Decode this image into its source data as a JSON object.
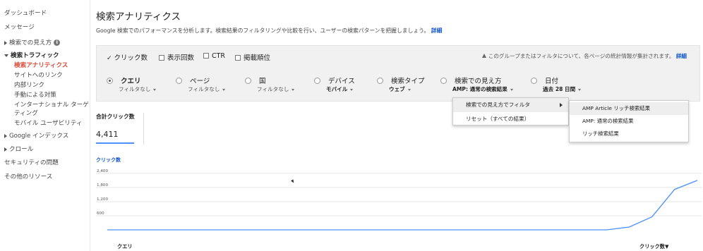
{
  "sidebar": {
    "dashboard": "ダッシュボード",
    "messages": "メッセージ",
    "search_appearance": "検索での見え方",
    "search_traffic": "検索トラフィック",
    "search_analytics": "検索アナリティクス",
    "links_to_site": "サイトへのリンク",
    "internal_links": "内部リンク",
    "manual_actions": "手動による対策",
    "intl_targeting_1": "インターナショナル ターゲ",
    "intl_targeting_2": "ティング",
    "mobile_usability": "モバイル ユーザビリティ",
    "google_index": "Google インデックス",
    "crawl": "クロール",
    "security_issues": "セキュリティの問題",
    "other_resources": "その他のリソース"
  },
  "header": {
    "title": "検索アナリティクス",
    "description": "Google 検索でのパフォーマンスを分析します。検索結果のフィルタリングや比較を行い、ユーザーの検索パターンを把握しましょう。",
    "details_link": "詳細"
  },
  "metrics": {
    "clicks": "クリック数",
    "impressions": "表示回数",
    "ctr": "CTR",
    "position": "掲載順位",
    "notice": "このグループまたはフィルタについて、各ページの統計情報が集計されます。",
    "notice_link": "詳細"
  },
  "dimensions": [
    {
      "label": "クエリ",
      "filter": "フィルタなし",
      "selected": true
    },
    {
      "label": "ページ",
      "filter": "フィルタなし",
      "selected": false
    },
    {
      "label": "国",
      "filter": "フィルタなし",
      "selected": false
    },
    {
      "label": "デバイス",
      "filter": "モバイル",
      "selected": false
    },
    {
      "label": "検索タイプ",
      "filter": "ウェブ",
      "selected": false
    },
    {
      "label": "検索での見え方",
      "filter": "AMP: 通常の検索結果",
      "selected": false
    },
    {
      "label": "日付",
      "filter": "過去 28 日間",
      "selected": false
    }
  ],
  "menu": {
    "filter_by_appearance": "検索での見え方でフィルタ",
    "reset": "リセット（すべての結果）"
  },
  "submenu": {
    "amp_rich": "AMP Article リッチ検索結果",
    "amp_normal": "AMP: 通常の検索結果",
    "rich": "リッチ検索結果"
  },
  "totals": {
    "label": "合計クリック数",
    "value": "4,411"
  },
  "chart_data": {
    "type": "line",
    "title": "",
    "legend": "クリック数",
    "yticks": [
      "2,400",
      "1,800",
      "1,200",
      "600"
    ],
    "ylim": [
      0,
      2400
    ],
    "series": [
      {
        "name": "クリック数",
        "color": "#4d90fe",
        "values": [
          0,
          0,
          0,
          0,
          0,
          0,
          0,
          0,
          0,
          0,
          0,
          0,
          0,
          0,
          0,
          0,
          0,
          0,
          0,
          0,
          0,
          0,
          0,
          120,
          550,
          1720,
          2100
        ]
      }
    ]
  },
  "table": {
    "col_query": "クエリ",
    "col_clicks": "クリック数▼"
  }
}
